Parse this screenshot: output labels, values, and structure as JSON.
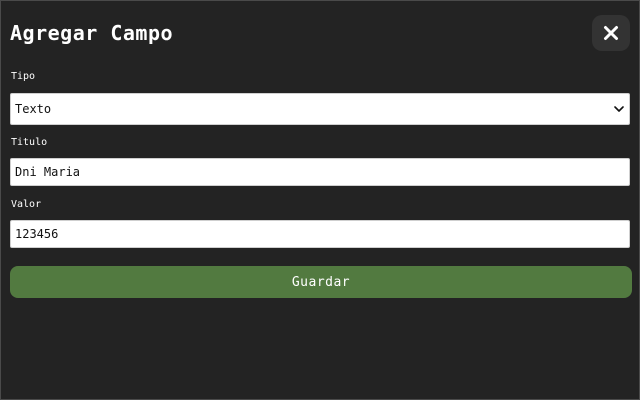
{
  "modal": {
    "title": "Agregar Campo",
    "close_icon": "close-icon"
  },
  "fields": {
    "tipo": {
      "label": "Tipo",
      "value": "Texto",
      "icon": "chevron-down-icon"
    },
    "titulo": {
      "label": "Titulo",
      "value": "Dni Maria"
    },
    "valor": {
      "label": "Valor",
      "value": "123456"
    }
  },
  "actions": {
    "save_label": "Guardar"
  },
  "colors": {
    "background": "#232323",
    "save_button": "#527a40",
    "close_button": "#333333"
  }
}
